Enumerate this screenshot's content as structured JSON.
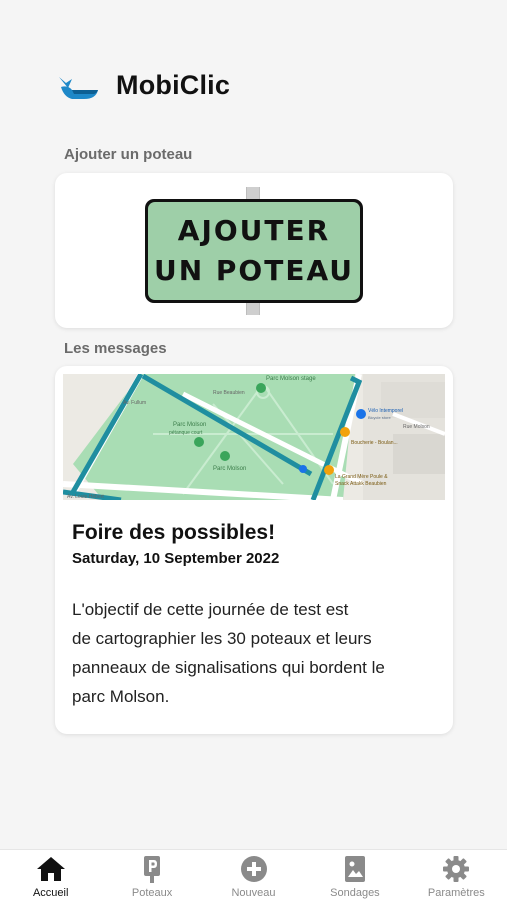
{
  "app": {
    "title": "MobiClic",
    "logo_icon": "whale-logo-icon",
    "accent_color": "#1e88c8"
  },
  "sections": {
    "add_pole_label": "Ajouter un poteau",
    "messages_label": "Les messages"
  },
  "add_pole_card": {
    "sign_line1": "AJOUTER",
    "sign_line2": "UN POTEAU",
    "sign_color": "#9ecfa8"
  },
  "message": {
    "map_labels": {
      "park_name": "Parc Molson",
      "park_sub": "pétanque court",
      "stage": "Parc Molson stage",
      "velo": "Vélo Intemporel",
      "velo_sub": "Bicycle store",
      "boucherie": "Boucherie - Boulan...",
      "grand_mere": "La Grand Mère Poule &",
      "snack": "Snack Attakk Beaubien",
      "street_rue": "Rue Molson",
      "street_louis": "Av. Louis-Hébert",
      "street_fullum": "Av. Fullum",
      "street_beaubien": "Rue Beaubien"
    },
    "title": "Foire des possibles!",
    "date": "Saturday, 10 September 2022",
    "body_lines": [
      "L'objectif de cette journée de test est",
      "de cartographier les 30 poteaux et leurs",
      "panneaux de signalisations qui bordent le",
      "parc Molson."
    ]
  },
  "tabbar": {
    "items": [
      {
        "label": "Accueil",
        "icon": "home-icon",
        "active": true
      },
      {
        "label": "Poteaux",
        "icon": "parking-sign-icon",
        "active": false
      },
      {
        "label": "Nouveau",
        "icon": "add-circle-icon",
        "active": false
      },
      {
        "label": "Sondages",
        "icon": "survey-image-icon",
        "active": false
      },
      {
        "label": "Paramètres",
        "icon": "gear-icon",
        "active": false
      }
    ]
  }
}
